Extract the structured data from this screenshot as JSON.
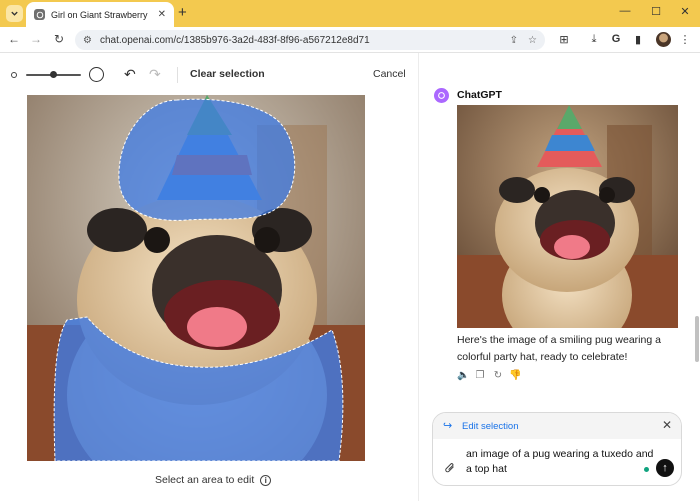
{
  "browser": {
    "tab_title": "Girl on Giant Strawberry",
    "url": "chat.openai.com/c/1385b976-3a2d-483f-8f96-a567212e8d71",
    "icons": {
      "tab_menu": "chevron-down-icon",
      "new_tab": "+",
      "minimize": "—",
      "maximize": "☐",
      "close": "✕",
      "back": "←",
      "forward": "→",
      "reload": "↻",
      "site_info": "⚙",
      "install": "⇪",
      "bookmark": "☆",
      "extensions": "⊞",
      "download": "⤓",
      "google": "G",
      "reading": "▮",
      "menu": "⋮"
    }
  },
  "editor": {
    "clear_selection_label": "Clear selection",
    "cancel_label": "Cancel",
    "select_hint": "Select an area to edit",
    "brush_size_level": 0.5,
    "undo_icon": "↶",
    "redo_icon": "↷",
    "info_icon": "i"
  },
  "chat": {
    "assistant_name": "ChatGPT",
    "reply_text": "Here's the image of a smiling pug wearing a colorful party hat, ready to celebrate!",
    "action_icons": [
      "🔈",
      "❐",
      "↻",
      "👎"
    ],
    "composer": {
      "edit_label": "Edit selection",
      "edit_icon": "↪",
      "close_icon": "✕",
      "input_text": "an image of a pug wearing a tuxedo and a top hat",
      "attach_icon": "📎",
      "send_icon": "↑"
    }
  },
  "colors": {
    "titlebar": "#f3c94f",
    "gpt_logo": "#ab68ff",
    "link_blue": "#1a73e8",
    "selection_overlay": "#3e7be6"
  }
}
